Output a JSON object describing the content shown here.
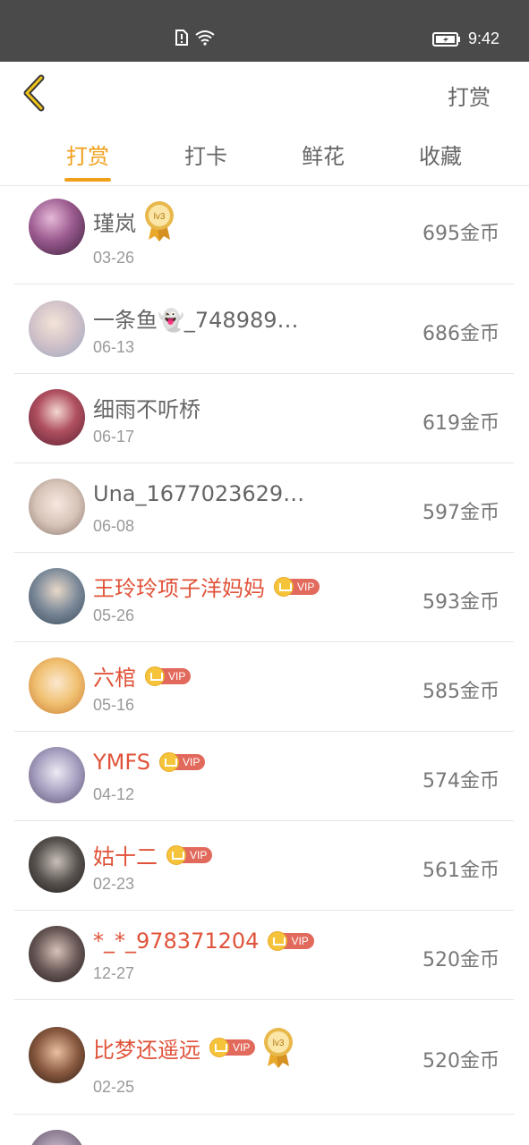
{
  "status_bar": {
    "time": "9:42"
  },
  "nav": {
    "right_label": "打赏"
  },
  "tabs": [
    {
      "label": "打赏",
      "active": true
    },
    {
      "label": "打卡",
      "active": false
    },
    {
      "label": "鲜花",
      "active": false
    },
    {
      "label": "收藏",
      "active": false
    }
  ],
  "list": [
    {
      "name": "瑾岚",
      "date": "03-26",
      "coins": "695金币",
      "vip": false,
      "medal": "lv3"
    },
    {
      "name": "一条鱼👻_748989…",
      "date": "06-13",
      "coins": "686金币",
      "vip": false
    },
    {
      "name": "细雨不听桥",
      "date": "06-17",
      "coins": "619金币",
      "vip": false
    },
    {
      "name": "Una_1677023629…",
      "date": "06-08",
      "coins": "597金币",
      "vip": false
    },
    {
      "name": "王玲玲项子洋妈妈",
      "date": "05-26",
      "coins": "593金币",
      "vip": true
    },
    {
      "name": "六棺",
      "date": "05-16",
      "coins": "585金币",
      "vip": true
    },
    {
      "name": "YMFS",
      "date": "04-12",
      "coins": "574金币",
      "vip": true
    },
    {
      "name": "姑十二",
      "date": "02-23",
      "coins": "561金币",
      "vip": true
    },
    {
      "name": "*_*_978371204",
      "date": "12-27",
      "coins": "520金币",
      "vip": true
    },
    {
      "name": "比梦还遥远",
      "date": "02-25",
      "coins": "520金币",
      "vip": true,
      "medal": "lv3"
    }
  ],
  "vip_label": "VIP",
  "colors": {
    "accent": "#f0a01a",
    "vip_name": "#e0533a",
    "status_bar": "#4a4a4a"
  }
}
